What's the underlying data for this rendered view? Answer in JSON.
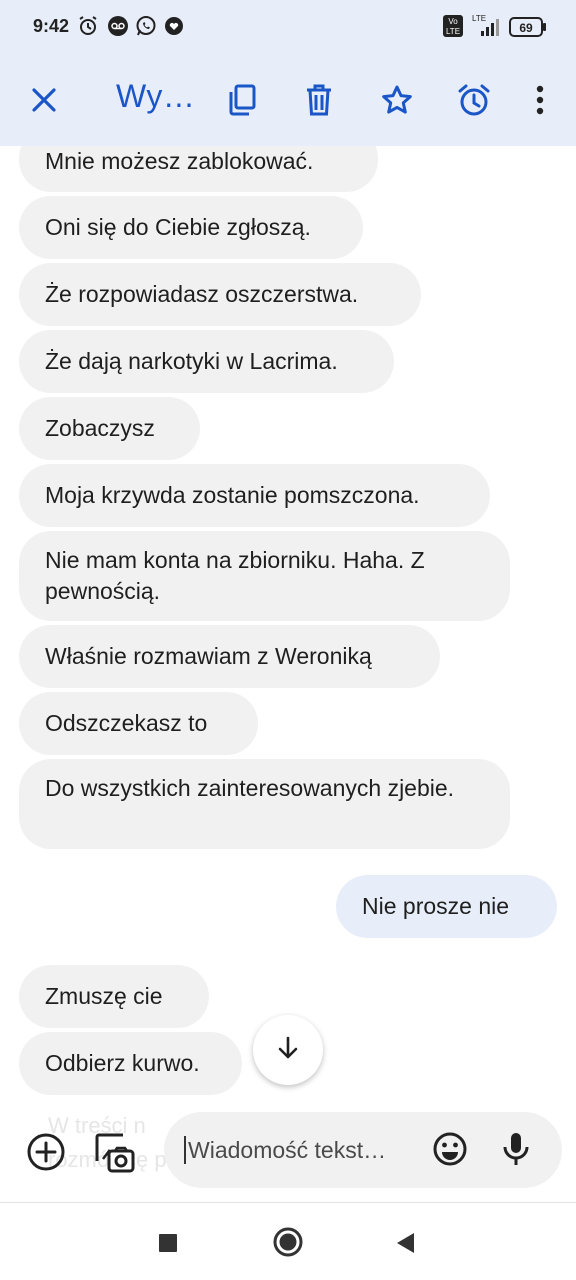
{
  "status_bar": {
    "time": "9:42",
    "volte_label": "Vo\nLTE",
    "lte_label": "LTE",
    "battery": "69",
    "icons": [
      "alarm-icon",
      "voicemail-icon",
      "whatsapp-icon",
      "heart-shield-icon",
      "volte-icon",
      "signal-icon",
      "battery-icon"
    ]
  },
  "app_bar": {
    "title": "Wy…",
    "icons": [
      "close-icon",
      "copy-icon",
      "delete-icon",
      "star-icon",
      "alarm-icon",
      "more-vert-icon"
    ],
    "accent_color": "#1a56c8"
  },
  "messages": [
    {
      "direction": "in",
      "text": "Mnie możesz zablokować."
    },
    {
      "direction": "in",
      "text": "Oni się do Ciebie zgłoszą."
    },
    {
      "direction": "in",
      "text": "Że rozpowiadasz oszczerstwa."
    },
    {
      "direction": "in",
      "text": "Że dają narkotyki w Lacrima."
    },
    {
      "direction": "in",
      "text": "Zobaczysz"
    },
    {
      "direction": "in",
      "text": "Moja krzywda zostanie pomszczona."
    },
    {
      "direction": "in",
      "text": "Nie mam konta na zbiorniku. Haha. Z pewnością."
    },
    {
      "direction": "in",
      "text": "Właśnie rozmawiam z Weroniką"
    },
    {
      "direction": "in",
      "text": "Odszczekasz to"
    },
    {
      "direction": "in",
      "text": "Do wszystkich zainteresowanych zjebie."
    },
    {
      "direction": "out",
      "text": "Nie prosze nie"
    },
    {
      "direction": "in",
      "text": "Zmuszę cie"
    },
    {
      "direction": "in",
      "text": "Odbierz kurwo."
    }
  ],
  "composer": {
    "placeholder": "Wiadomość tekst…",
    "ghost_line_1": "W treści n",
    "ghost_line_2": "rozmówcę po",
    "icons": [
      "add-circle-icon",
      "gallery-icon",
      "emoji-icon",
      "mic-icon"
    ]
  },
  "nav_bar": {
    "icons": [
      "recents-square-icon",
      "home-circle-icon",
      "back-triangle-icon"
    ]
  }
}
